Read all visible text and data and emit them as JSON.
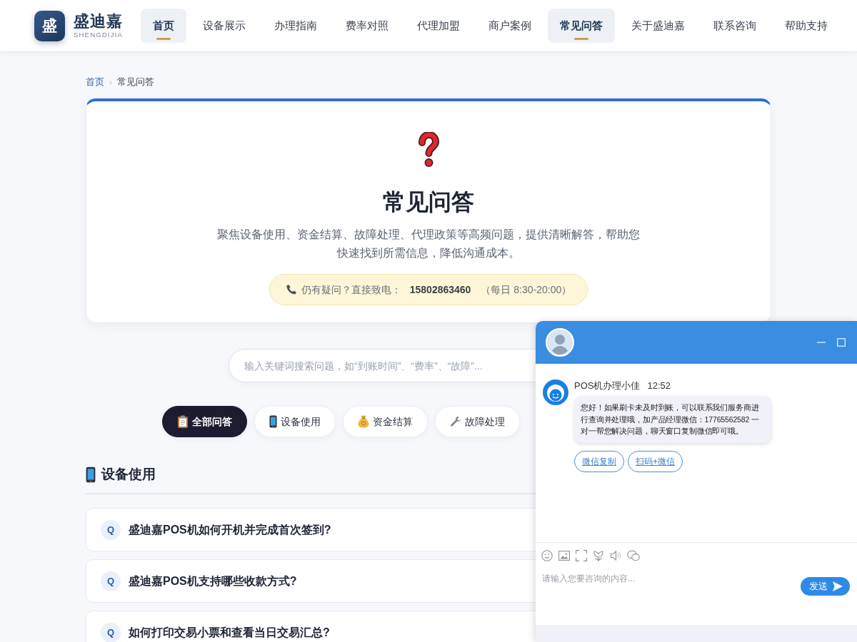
{
  "header": {
    "logo": {
      "mark": "盛",
      "name": "盛迪嘉",
      "subtitle": "SHENGDIJIA"
    },
    "nav": [
      {
        "label": "首页",
        "selected": true
      },
      {
        "label": "设备展示",
        "selected": false
      },
      {
        "label": "办理指南",
        "selected": false
      },
      {
        "label": "费率对照",
        "selected": false
      },
      {
        "label": "代理加盟",
        "selected": false
      },
      {
        "label": "商户案例",
        "selected": false
      },
      {
        "label": "常见问答",
        "selected": true
      },
      {
        "label": "关于盛迪嘉",
        "selected": false
      },
      {
        "label": "联系咨询",
        "selected": false
      },
      {
        "label": "帮助支持",
        "selected": false
      }
    ]
  },
  "breadcrumb": {
    "items": [
      "首页",
      "常见问答"
    ],
    "separator": "›"
  },
  "hero": {
    "title": "常见问答",
    "description": "聚焦设备使用、资金结算、故障处理、代理政策等高频问题，提供清晰解答，帮助您快速找到所需信息，降低沟通成本。",
    "contact": {
      "label": "仍有疑问？直接致电：",
      "phone": "15802863460",
      "hours": "（每日 8:30-20:00）"
    }
  },
  "search": {
    "placeholder": "输入关键词搜索问题，如“到账时间”、“费率”、“故障”..."
  },
  "categories": [
    {
      "kind": "all",
      "label": "全部问答",
      "selected": true
    },
    {
      "kind": "device",
      "label": "设备使用",
      "selected": false
    },
    {
      "kind": "funds",
      "label": "资金结算",
      "selected": false
    },
    {
      "kind": "repair",
      "label": "故障处理",
      "selected": false
    }
  ],
  "section": {
    "kind": "device",
    "title": "设备使用",
    "questions": [
      {
        "badge": "Q",
        "text": "盛迪嘉POS机如何开机并完成首次签到?"
      },
      {
        "badge": "Q",
        "text": "盛迪嘉POS机支持哪些收款方式?"
      },
      {
        "badge": "Q",
        "text": "如何打印交易小票和查看当日交易汇总?"
      }
    ]
  },
  "chat": {
    "messages": [
      {
        "sender": "POS机办理小佳",
        "time": "12:52",
        "text": "您好！如果刷卡未及时到账，可以联系我们服务商进行查询并处理哦，加产品经理微信：17765562582 一对一帮您解决问题，聊天窗口复制微信即可哦。",
        "actions": [
          "微信复制",
          "扫码+微信"
        ]
      }
    ],
    "input": {
      "placeholder": "请输入您要咨询的内容..."
    },
    "send": "发送"
  }
}
